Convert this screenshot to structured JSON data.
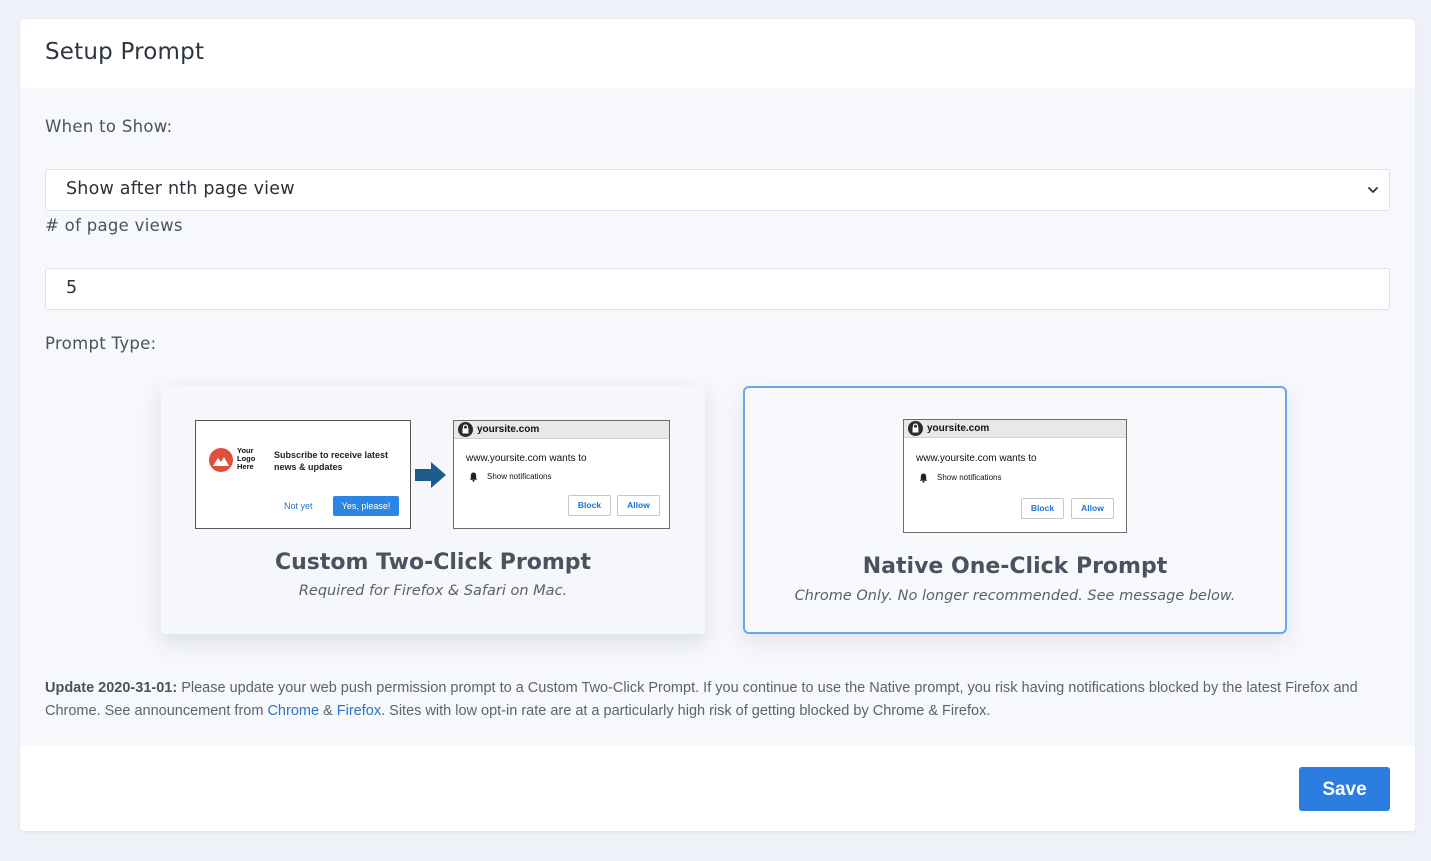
{
  "header": {
    "title": "Setup Prompt"
  },
  "when_to_show": {
    "label": "When to Show:",
    "selected": "Show after nth page view"
  },
  "page_views": {
    "label": "# of page views",
    "value": "5"
  },
  "prompt_type": {
    "label": "Prompt Type:",
    "options": [
      {
        "title": "Custom Two-Click Prompt",
        "subtitle": "Required for Firefox & Safari on Mac.",
        "selected": false,
        "preview": {
          "logo_text": "Your Logo Here",
          "subscribe_text": "Subscribe to receive latest news & updates",
          "not_yet": "Not yet",
          "yes": "Yes, please!",
          "site": "yoursite.com",
          "wants": "www.yoursite.com wants to",
          "notif": "Show notifications",
          "block": "Block",
          "allow": "Allow"
        }
      },
      {
        "title": "Native One-Click Prompt",
        "subtitle": "Chrome Only. No longer recommended. See message below.",
        "selected": true,
        "preview": {
          "site": "yoursite.com",
          "wants": "www.yoursite.com wants to",
          "notif": "Show notifications",
          "block": "Block",
          "allow": "Allow"
        }
      }
    ]
  },
  "update_notice": {
    "bold": "Update 2020-31-01:",
    "text1": " Please update your web push permission prompt to a Custom Two-Click Prompt. If you continue to use the Native prompt, you risk having notifications blocked by the latest Firefox and Chrome. See announcement from ",
    "link_chrome": "Chrome",
    "amp": " & ",
    "link_firefox": "Firefox",
    "text2": ". Sites with low opt-in rate are at a particularly high risk of getting blocked by Chrome & Firefox."
  },
  "footer": {
    "save_label": "Save"
  },
  "colors": {
    "accent": "#2b7de0",
    "selected_border": "#6aa6ee",
    "link": "#2b74c9",
    "arrow": "#1d5b8a",
    "logo_red": "#e0503c"
  }
}
